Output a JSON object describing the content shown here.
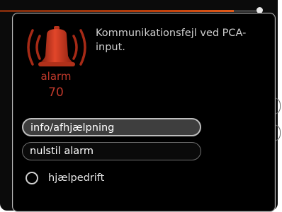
{
  "alarm": {
    "label": "alarm",
    "code": "70",
    "message": "Kommunikationsfejl ved PCA-input.",
    "icon": "alarm-bell-icon",
    "color": "#c0392b"
  },
  "actions": {
    "info_label": "info/afhjælpning",
    "reset_label": "nulstil alarm"
  },
  "options": {
    "aid_mode_label": "hjælpedrift",
    "aid_mode_selected": false
  },
  "colors": {
    "accent": "#c2410c",
    "dialog_bg": "#000000",
    "text": "#cfcfcf"
  }
}
